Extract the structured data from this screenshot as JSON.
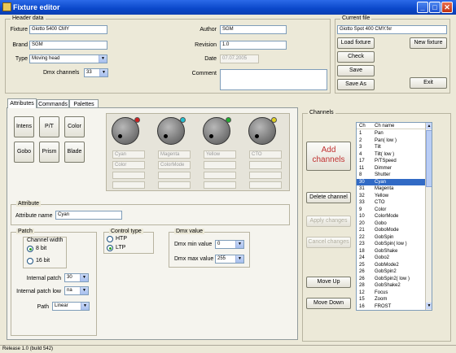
{
  "window": {
    "title": "Fixture editor",
    "minimize": "_",
    "maximize": "□",
    "close": "✕"
  },
  "header": {
    "group_label": "Header data",
    "fixture_label": "Fixture",
    "fixture_value": "Giotto 5400 CMY",
    "brand_label": "Brand",
    "brand_value": "SGM",
    "type_label": "Type",
    "type_value": "Moving head",
    "dmx_channels_label": "Dmx channels",
    "dmx_channels_value": "33",
    "author_label": "Author",
    "author_value": "SGM",
    "revision_label": "Revision",
    "revision_value": "1.0",
    "date_label": "Date",
    "date_value": "07.07.2005",
    "comment_label": "Comment",
    "comment_value": ""
  },
  "current_file": {
    "group_label": "Current file",
    "file_value": "Giotto Spot 400 CMY.fxr",
    "load_fixture": "Load fixture",
    "new_fixture": "New fixture",
    "check": "Check",
    "save": "Save",
    "save_as": "Save As",
    "exit": "Exit"
  },
  "tabs": [
    "Attributes",
    "Commands",
    "Palettes"
  ],
  "attr_buttons": [
    "Intens",
    "P/T",
    "Color",
    "Gobo",
    "Prism",
    "Blade"
  ],
  "knobs": [
    {
      "name": "Cyan",
      "sub": "Color",
      "led": "#d02020"
    },
    {
      "name": "Magenta",
      "sub": "ColorMode",
      "led": "#20c0d0"
    },
    {
      "name": "Yellow",
      "sub": "",
      "led": "#20b030"
    },
    {
      "name": "CTO",
      "sub": "",
      "led": "#e0d020"
    }
  ],
  "attribute": {
    "group_label": "Attribute",
    "name_label": "Attribute name",
    "name_value": "Cyan"
  },
  "patch": {
    "group_label": "Patch",
    "channel_width_label": "Channel width",
    "bit8": "8 bit",
    "bit16": "16 bit",
    "internal_patch_label": "Internal patch",
    "internal_patch_value": "30",
    "internal_patch_low_label": "Internal patch low",
    "internal_patch_low_value": "na",
    "path_label": "Path",
    "path_value": "Linear"
  },
  "control_type": {
    "group_label": "Control type",
    "htp": "HTP",
    "ltp": "LTP"
  },
  "dmx_value": {
    "group_label": "Dmx value",
    "min_label": "Dmx min value",
    "min_value": "0",
    "max_label": "Dmx max value",
    "max_value": "255"
  },
  "channels": {
    "group_label": "Channels",
    "add_channels": "Add channels",
    "delete_channel": "Delete channel",
    "apply_changes": "Apply changes",
    "cancel_changes": "Cancel changes",
    "move_up": "Move Up",
    "move_down": "Move Down",
    "col_ch": "Ch",
    "col_name": "Ch name",
    "rows": [
      [
        "1",
        "Pan"
      ],
      [
        "2",
        "Pan( low )"
      ],
      [
        "3",
        "Tilt"
      ],
      [
        "4",
        "Tilt( low )"
      ],
      [
        "17",
        "P/TSpeed"
      ],
      [
        "11",
        "Dimmer"
      ],
      [
        "8",
        "Shutter"
      ],
      [
        "30",
        "Cyan"
      ],
      [
        "31",
        "Magenta"
      ],
      [
        "32",
        "Yellow"
      ],
      [
        "33",
        "CTO"
      ],
      [
        "9",
        "Color"
      ],
      [
        "10",
        "ColorMode"
      ],
      [
        "20",
        "Gobo"
      ],
      [
        "21",
        "GoboMode"
      ],
      [
        "22",
        "GobSpin"
      ],
      [
        "23",
        "GobSpin( low )"
      ],
      [
        "18",
        "GobShake"
      ],
      [
        "24",
        "Gobo2"
      ],
      [
        "25",
        "GobMode2"
      ],
      [
        "26",
        "GobSpin2"
      ],
      [
        "26",
        "GobSpin2( low )"
      ],
      [
        "28",
        "GobShake2"
      ],
      [
        "12",
        "Focus"
      ],
      [
        "15",
        "Zoom"
      ],
      [
        "16",
        "FROST"
      ]
    ],
    "selected_index": 7
  },
  "status": {
    "text": "Release 1.0 (build 542)"
  }
}
